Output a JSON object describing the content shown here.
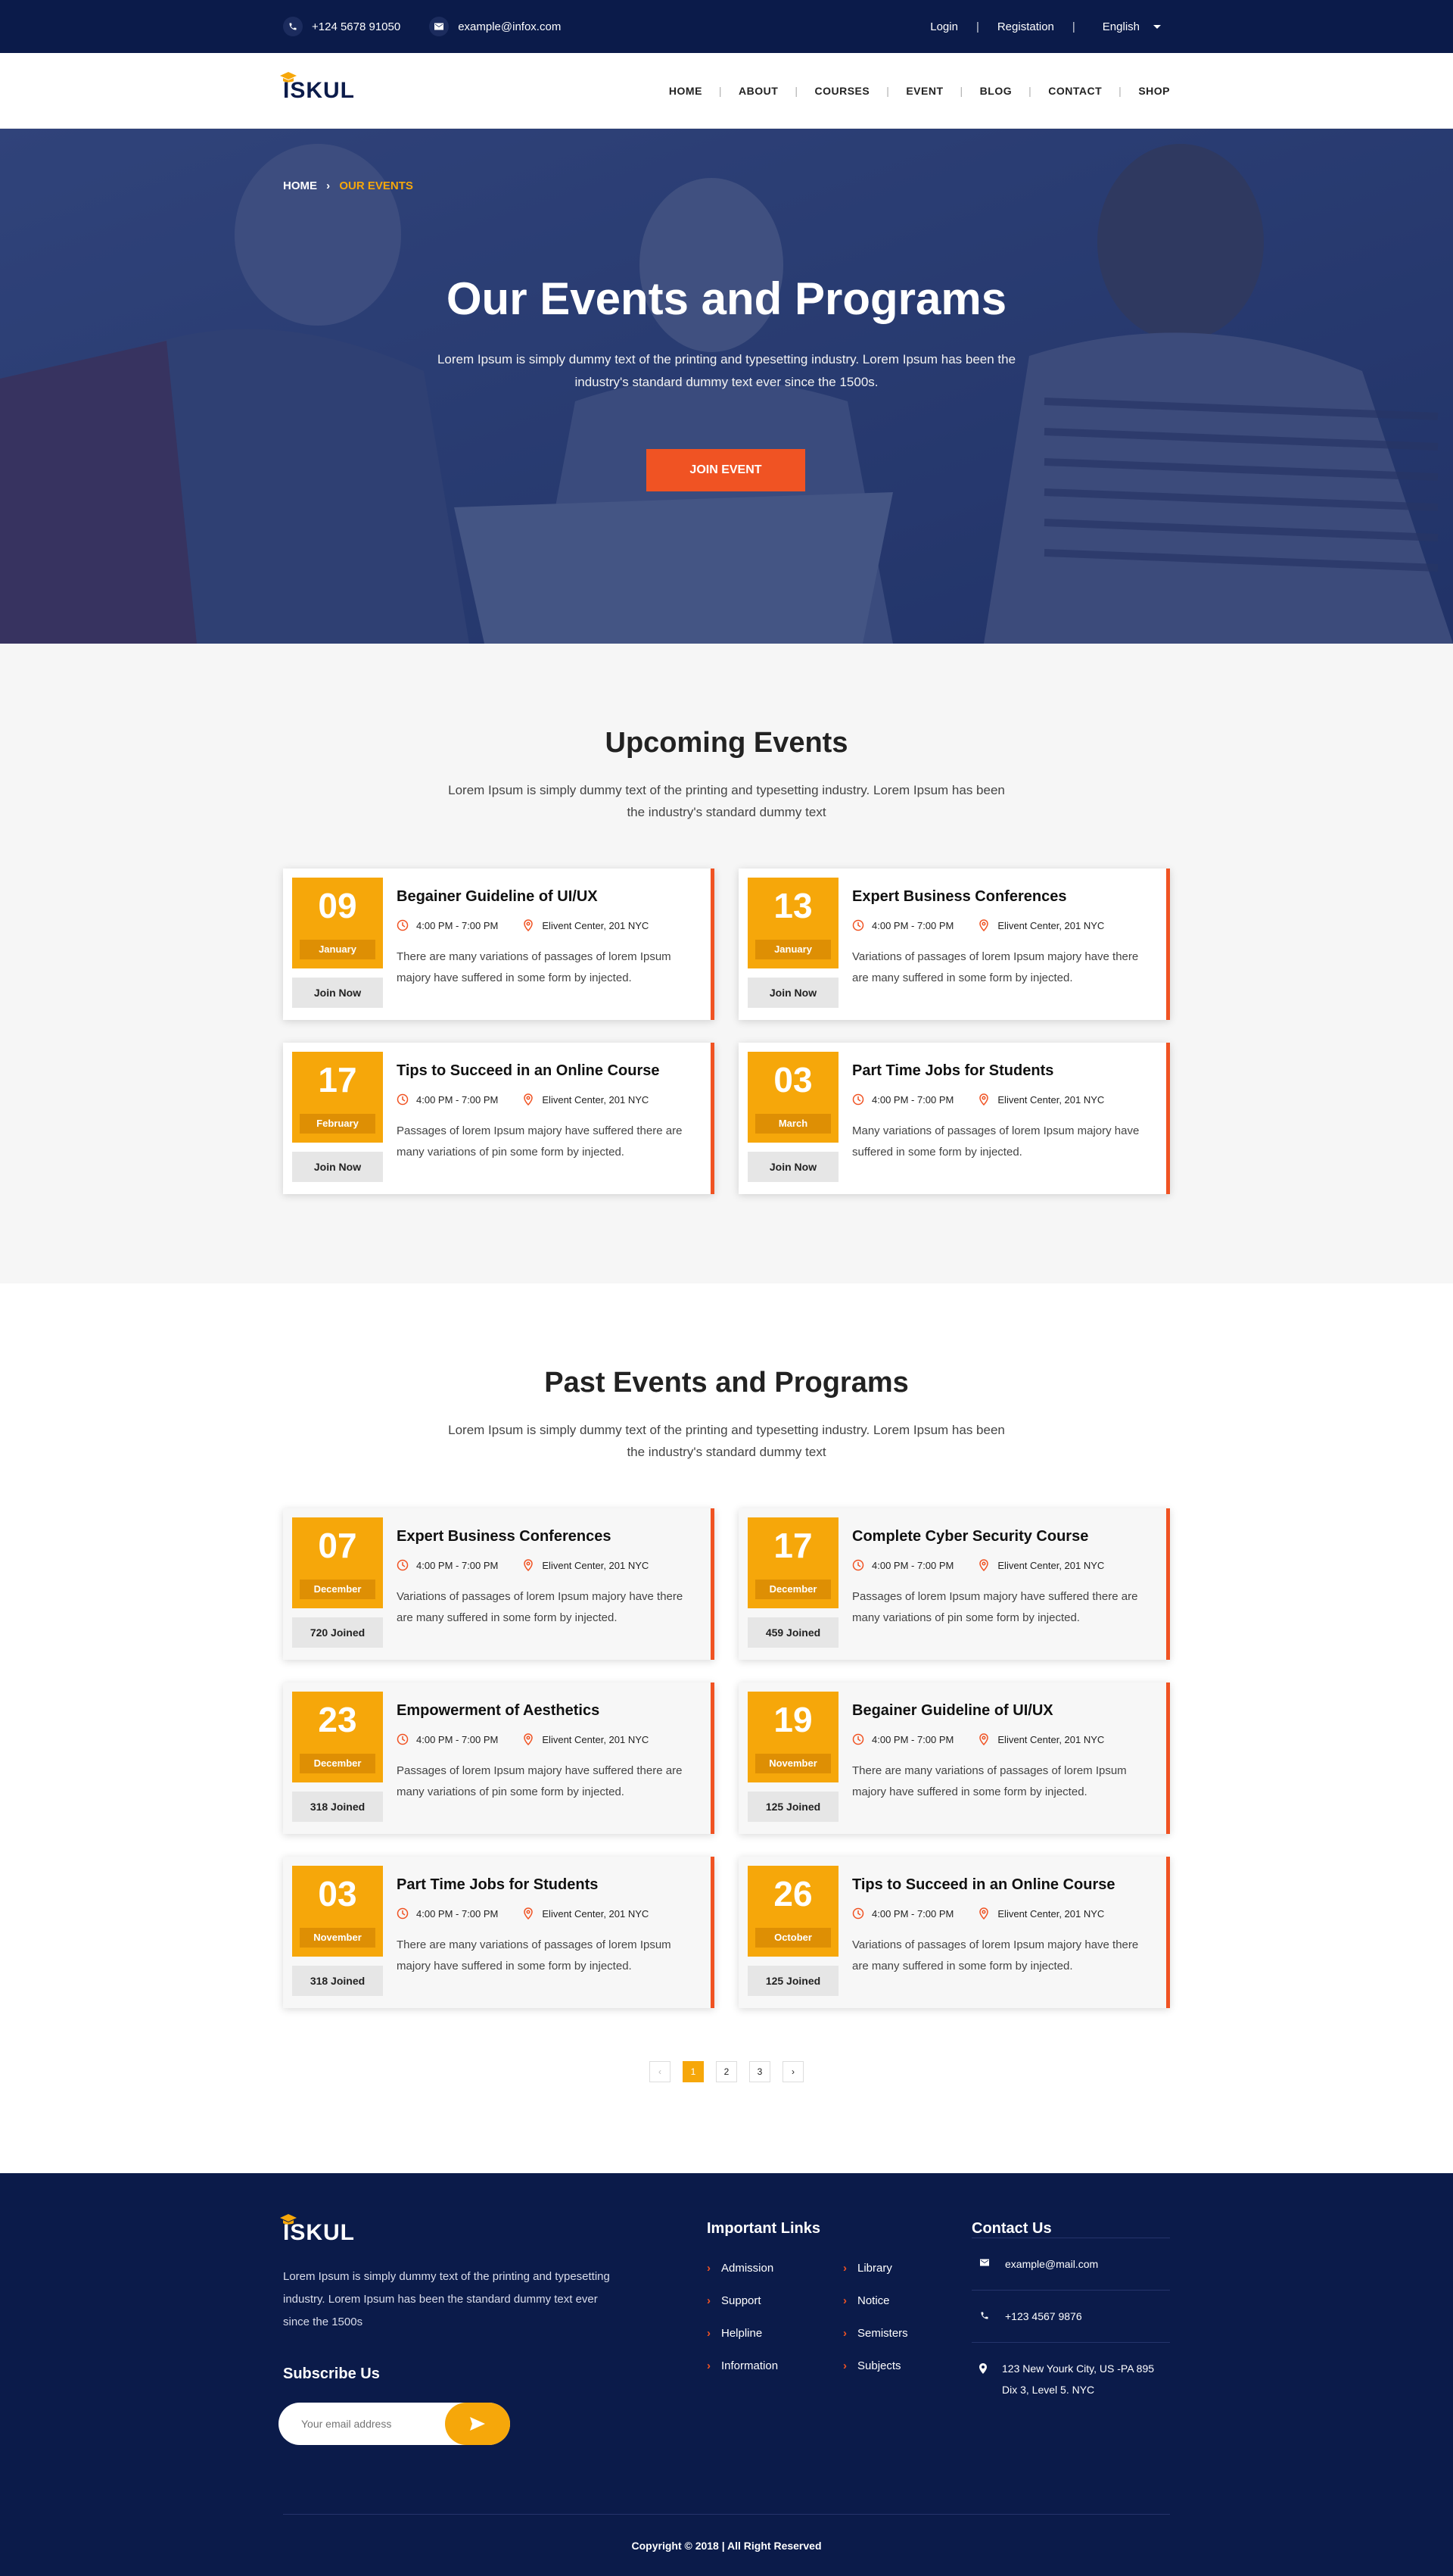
{
  "topbar": {
    "phone": "+124 5678 91050",
    "email": "example@infox.com",
    "login": "Login",
    "registration": "Registation",
    "language": "English"
  },
  "header": {
    "logo": "ISKUL",
    "nav": [
      "HOME",
      "ABOUT",
      "COURSES",
      "EVENT",
      "BLOG",
      "CONTACT",
      "SHOP"
    ]
  },
  "hero": {
    "crumb_home": "HOME",
    "crumb_current": "OUR EVENTS",
    "title": "Our Events and Programs",
    "text": "Lorem Ipsum is simply dummy text of the printing and typesetting industry. Lorem Ipsum has been the industry's standard dummy text ever since the 1500s.",
    "button": "JOIN EVENT"
  },
  "upcoming": {
    "title": "Upcoming Events",
    "subtitle": "Lorem Ipsum is simply dummy text of the printing and typesetting industry. Lorem Ipsum has been the industry's standard dummy text",
    "events": [
      {
        "day": "09",
        "month": "January",
        "title": "Begainer Guideline of UI/UX",
        "time": "4:00 PM - 7:00 PM",
        "place": "Elivent Center, 201 NYC",
        "desc": "There are many variations of passages of lorem Ipsum majory have suffered in some form by injected.",
        "button": "Join Now"
      },
      {
        "day": "13",
        "month": "January",
        "title": "Expert Business Conferences",
        "time": "4:00 PM - 7:00 PM",
        "place": "Elivent Center, 201 NYC",
        "desc": "Variations of passages of lorem Ipsum majory have there are many suffered in some form by injected.",
        "button": "Join Now"
      },
      {
        "day": "17",
        "month": "February",
        "title": "Tips to Succeed in an Online Course",
        "time": "4:00 PM - 7:00 PM",
        "place": "Elivent Center, 201 NYC",
        "desc": "Passages of lorem Ipsum majory have suffered there are many variations of pin some form by injected.",
        "button": "Join Now"
      },
      {
        "day": "03",
        "month": "March",
        "title": "Part Time Jobs for Students",
        "time": "4:00 PM - 7:00 PM",
        "place": "Elivent Center, 201 NYC",
        "desc": "Many variations of passages of lorem Ipsum majory have suffered in some form by injected.",
        "button": "Join Now"
      }
    ]
  },
  "past": {
    "title": "Past Events and Programs",
    "subtitle": "Lorem Ipsum is simply dummy text of the printing and typesetting industry. Lorem Ipsum has been the industry's standard dummy text",
    "events": [
      {
        "day": "07",
        "month": "December",
        "title": "Expert Business Conferences",
        "time": "4:00 PM - 7:00 PM",
        "place": "Elivent Center, 201 NYC",
        "desc": "Variations of passages of lorem Ipsum majory have there are many suffered in some form by injected.",
        "button": "720 Joined"
      },
      {
        "day": "17",
        "month": "December",
        "title": "Complete Cyber Security Course",
        "time": "4:00 PM - 7:00 PM",
        "place": "Elivent Center, 201 NYC",
        "desc": "Passages of lorem Ipsum majory have suffered there are many variations of pin some form by injected.",
        "button": "459 Joined"
      },
      {
        "day": "23",
        "month": "December",
        "title": "Empowerment of Aesthetics",
        "time": "4:00 PM - 7:00 PM",
        "place": "Elivent Center, 201 NYC",
        "desc": "Passages of lorem Ipsum majory have suffered there are many variations of pin some form by injected.",
        "button": "318 Joined"
      },
      {
        "day": "19",
        "month": "November",
        "title": "Begainer Guideline of UI/UX",
        "time": "4:00 PM - 7:00 PM",
        "place": "Elivent Center, 201 NYC",
        "desc": "There are many variations of passages of lorem Ipsum majory have suffered in some form by injected.",
        "button": "125 Joined"
      },
      {
        "day": "03",
        "month": "November",
        "title": "Part Time Jobs for Students",
        "time": "4:00 PM - 7:00 PM",
        "place": "Elivent Center, 201 NYC",
        "desc": "There are many variations of passages of lorem Ipsum majory have suffered in some form by injected.",
        "button": "318 Joined"
      },
      {
        "day": "26",
        "month": "October",
        "title": "Tips to Succeed in an Online Course",
        "time": "4:00 PM - 7:00 PM",
        "place": "Elivent Center, 201 NYC",
        "desc": "Variations of passages of lorem Ipsum majory have there are many suffered in some form by injected.",
        "button": "125 Joined"
      }
    ]
  },
  "pagination": {
    "prev": "‹",
    "pages": [
      "1",
      "2",
      "3"
    ],
    "next": "›",
    "current": "1"
  },
  "footer": {
    "logo": "ISKUL",
    "about": "Lorem Ipsum is simply dummy text of the printing and typesetting industry. Lorem Ipsum has been the standard dummy text ever since the 1500s",
    "subscribe_title": "Subscribe Us",
    "subscribe_placeholder": "Your email address",
    "links_title": "Important Links",
    "links": [
      "Admission",
      "Library",
      "Support",
      "Notice",
      "Helpline",
      "Semisters",
      "Information",
      "Subjects"
    ],
    "contact_title": "Contact Us",
    "contact_email": "example@mail.com",
    "contact_phone": "+123 4567 9876",
    "contact_address": "123 New Yourk City, US -PA 895 Dix 3, Level 5. NYC",
    "copyright": "Copyright © 2018 |  All Right Reserved"
  },
  "colors": {
    "navy": "#0b1b4a",
    "accent_orange": "#f6a70a",
    "accent_red": "#f05323"
  }
}
